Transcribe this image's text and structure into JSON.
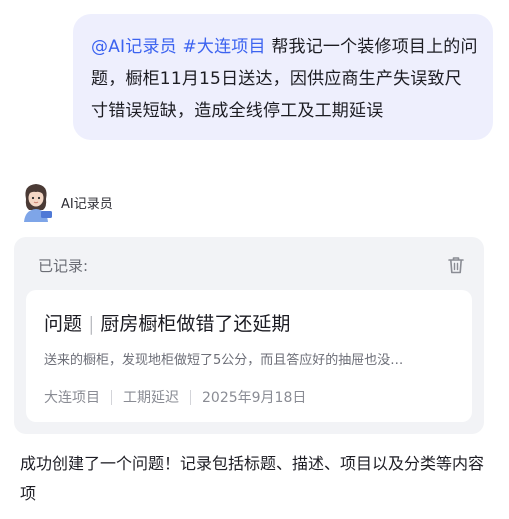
{
  "user_message": {
    "mention_recorder": "@AI记录员",
    "mention_project": "#大连项目",
    "text": "帮我记一个装修项目上的问题，橱柜11月15日送达，因供应商生产失误致尺寸错误短缺，造成全线停工及工期延误"
  },
  "assistant": {
    "name": "AI记录员"
  },
  "record": {
    "header_label": "已记录:",
    "trash_icon": "trash-icon",
    "issue": {
      "type_label": "问题",
      "separator": "|",
      "title": "厨房橱柜做错了还延期",
      "description": "送来的橱柜，发现地柜做短了5公分，而且答应好的抽屉也没…",
      "project": "大连项目",
      "category": "工期延迟",
      "date": "2025年9月18日"
    }
  },
  "reply": {
    "text": "成功创建了一个问题！记录包括标题、描述、项目以及分类等内容项"
  },
  "colors": {
    "mention": "#3c63f0",
    "user_bubble": "#eeeffd",
    "card_bg": "#f2f3f6"
  }
}
